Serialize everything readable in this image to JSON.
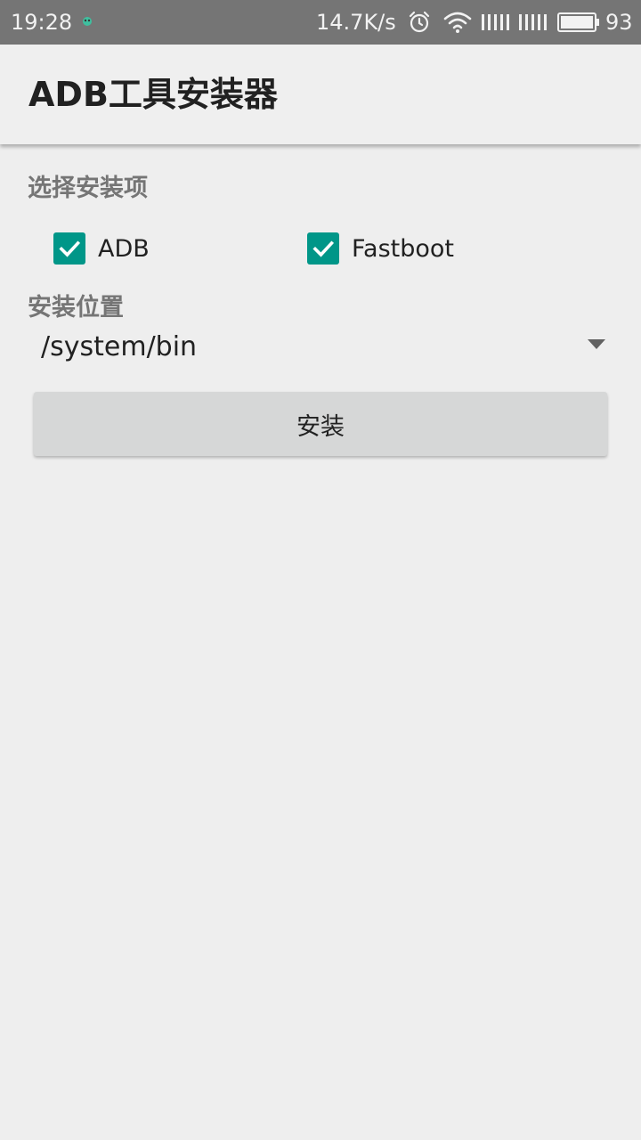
{
  "status_bar": {
    "time": "19:28",
    "network_speed": "14.7K/s",
    "battery_level": "93",
    "icons": [
      "app-notification-icon",
      "alarm-icon",
      "wifi-icon",
      "signal-icon",
      "signal-icon",
      "battery-icon"
    ]
  },
  "app_bar": {
    "title": "ADB工具安装器"
  },
  "options": {
    "section_label": "选择安装项",
    "checkboxes": [
      {
        "label": "ADB",
        "checked": true
      },
      {
        "label": "Fastboot",
        "checked": true
      }
    ]
  },
  "location": {
    "section_label": "安装位置",
    "selected": "/system/bin"
  },
  "install_button": {
    "label": "安装"
  },
  "colors": {
    "status_bar": "#757575",
    "accent": "#009688",
    "background": "#eeeeee",
    "button": "#d6d7d7"
  }
}
